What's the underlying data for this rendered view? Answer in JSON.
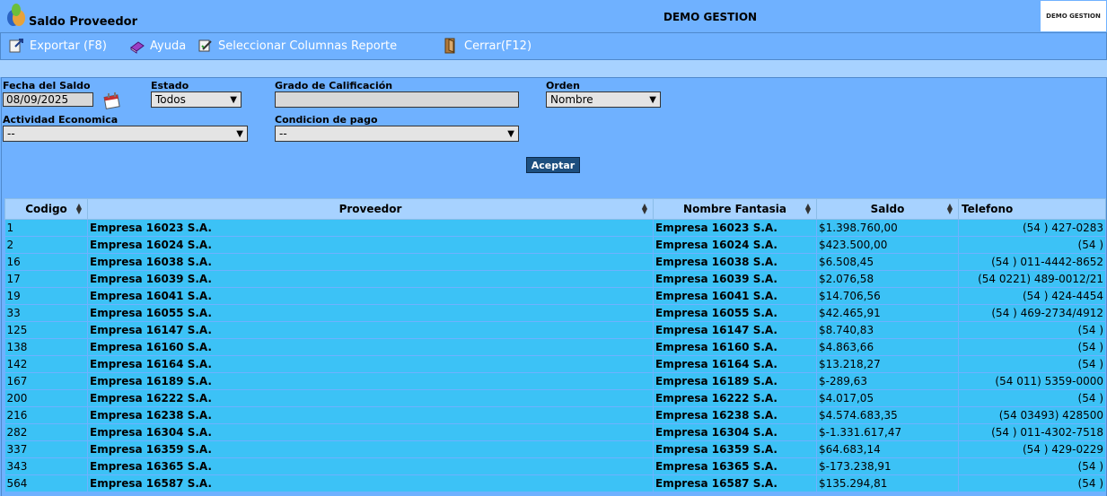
{
  "header": {
    "app_title": "Saldo Proveedor",
    "center_title": "DEMO GESTION",
    "brand": "DEMO GESTION"
  },
  "toolbar": {
    "export": "Exportar (F8)",
    "help": "Ayuda",
    "columns": "Seleccionar Columnas Reporte",
    "close": "Cerrar(F12)"
  },
  "filters": {
    "fecha_label": "Fecha del Saldo",
    "fecha_value": "08/09/2025",
    "estado_label": "Estado",
    "estado_value": "Todos",
    "grado_label": "Grado de Calificación",
    "grado_value": "",
    "orden_label": "Orden",
    "orden_value": "Nombre",
    "actividad_label": "Actividad Economica",
    "actividad_value": "--",
    "condicion_label": "Condicion de pago",
    "condicion_value": "--",
    "accept": "Aceptar"
  },
  "table": {
    "headers": [
      "Codigo",
      "Proveedor",
      "Nombre Fantasia",
      "Saldo",
      "Telefono"
    ],
    "rows": [
      [
        "1",
        "Empresa 16023 S.A.",
        "Empresa 16023 S.A.",
        "$1.398.760,00",
        "(54 ) 427-0283"
      ],
      [
        "2",
        "Empresa 16024 S.A.",
        "Empresa 16024 S.A.",
        "$423.500,00",
        "(54 )"
      ],
      [
        "16",
        "Empresa 16038 S.A.",
        "Empresa 16038 S.A.",
        "$6.508,45",
        "(54 ) 011-4442-8652"
      ],
      [
        "17",
        "Empresa 16039 S.A.",
        "Empresa 16039 S.A.",
        "$2.076,58",
        "(54 0221) 489-0012/21"
      ],
      [
        "19",
        "Empresa 16041 S.A.",
        "Empresa 16041 S.A.",
        "$14.706,56",
        "(54 ) 424-4454"
      ],
      [
        "33",
        "Empresa 16055 S.A.",
        "Empresa 16055 S.A.",
        "$42.465,91",
        "(54 ) 469-2734/4912"
      ],
      [
        "125",
        "Empresa 16147 S.A.",
        "Empresa 16147 S.A.",
        "$8.740,83",
        "(54 )"
      ],
      [
        "138",
        "Empresa 16160 S.A.",
        "Empresa 16160 S.A.",
        "$4.863,66",
        "(54 )"
      ],
      [
        "142",
        "Empresa 16164 S.A.",
        "Empresa 16164 S.A.",
        "$13.218,27",
        "(54 )"
      ],
      [
        "167",
        "Empresa 16189 S.A.",
        "Empresa 16189 S.A.",
        "$-289,63",
        "(54 011) 5359-0000"
      ],
      [
        "200",
        "Empresa 16222 S.A.",
        "Empresa 16222 S.A.",
        "$4.017,05",
        "(54 )"
      ],
      [
        "216",
        "Empresa 16238 S.A.",
        "Empresa 16238 S.A.",
        "$4.574.683,35",
        "(54 03493) 428500"
      ],
      [
        "282",
        "Empresa 16304 S.A.",
        "Empresa 16304 S.A.",
        "$-1.331.617,47",
        "(54 ) 011-4302-7518"
      ],
      [
        "337",
        "Empresa 16359 S.A.",
        "Empresa 16359 S.A.",
        "$64.683,14",
        "(54 ) 429-0229"
      ],
      [
        "343",
        "Empresa 16365 S.A.",
        "Empresa 16365 S.A.",
        "$-173.238,91",
        "(54 )"
      ],
      [
        "564",
        "Empresa 16587 S.A.",
        "Empresa 16587 S.A.",
        "$135.294,81",
        "(54 )"
      ]
    ]
  }
}
